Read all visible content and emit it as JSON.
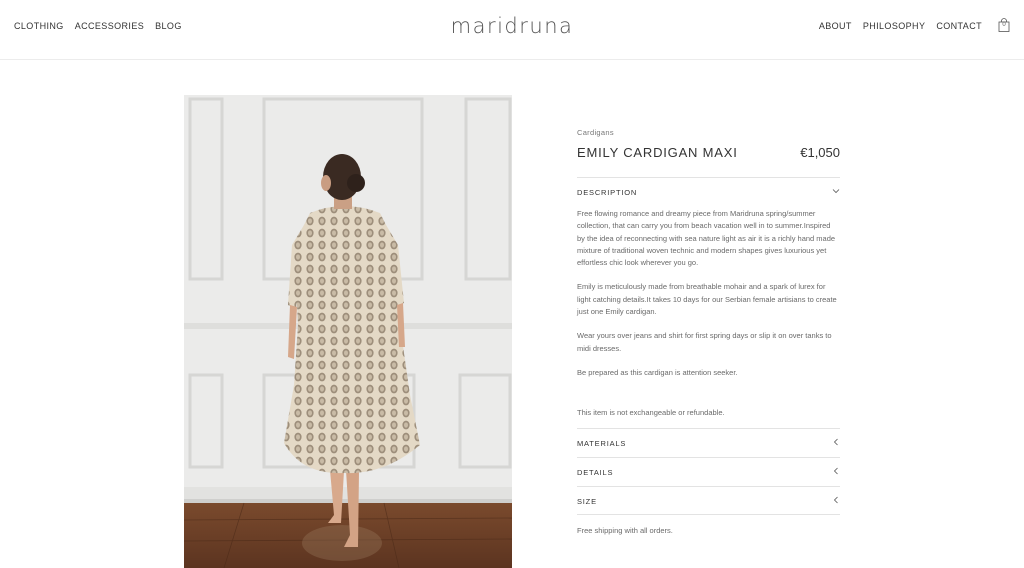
{
  "header": {
    "nav_left": [
      "CLOTHING",
      "ACCESSORIES",
      "BLOG"
    ],
    "logo": "maridruna",
    "nav_right": [
      "ABOUT",
      "PHILOSOPHY",
      "CONTACT"
    ],
    "cart_count": "0"
  },
  "product": {
    "category": "Cardigans",
    "title": "EMILY CARDIGAN MAXI",
    "price": "€1,050",
    "description_label": "DESCRIPTION",
    "description": [
      "Free flowing romance and dreamy piece from Maridruna spring/summer collection, that can carry you from beach vacation well in to summer.Inspired by the idea of reconnecting with sea nature light as air it is a richly hand made mixture of traditional woven technic and modern shapes gives luxurious yet effortless chic look wherever you go.",
      "Emily is meticulously made from breathable mohair and a spark of lurex for light catching details.It takes 10 days for our Serbian female artisians to create just one Emily cardigan.",
      "Wear yours over jeans and shirt for first spring days or slip it on over tanks to midi dresses.",
      "Be prepared as this cardigan is attention seeker."
    ],
    "policy": "This item is not exchangeable or refundable.",
    "accordions": [
      "MATERIALS",
      "DETAILS",
      "SIZE"
    ],
    "shipping": "Free shipping with all orders."
  }
}
